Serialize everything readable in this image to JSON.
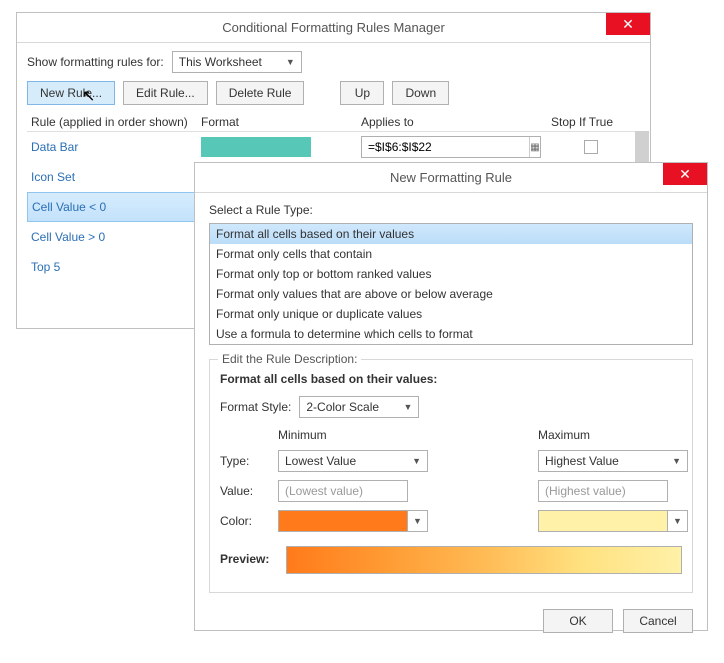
{
  "manager": {
    "title": "Conditional Formatting Rules Manager",
    "show_label": "Show formatting rules for:",
    "scope": "This Worksheet",
    "buttons": {
      "new": "New Rule...",
      "edit": "Edit Rule...",
      "delete": "Delete Rule",
      "up": "Up",
      "down": "Down"
    },
    "columns": {
      "rule": "Rule (applied in order shown)",
      "format": "Format",
      "applies": "Applies to",
      "stop": "Stop If True"
    },
    "rules": [
      {
        "name": "Data Bar",
        "applies": "=$I$6:$I$22"
      },
      {
        "name": "Icon Set"
      },
      {
        "name": "Cell Value < 0"
      },
      {
        "name": "Cell Value > 0"
      },
      {
        "name": "Top 5"
      }
    ]
  },
  "newRule": {
    "title": "New Formatting Rule",
    "select_label": "Select a Rule Type:",
    "types": [
      "Format all cells based on their values",
      "Format only cells that contain",
      "Format only top or bottom ranked values",
      "Format only values that are above or below average",
      "Format only unique or duplicate values",
      "Use a formula to determine which cells to format"
    ],
    "edit_legend": "Edit the Rule Description:",
    "heading": "Format all cells based on their values:",
    "format_style_label": "Format Style:",
    "format_style": "2-Color Scale",
    "min_label": "Minimum",
    "max_label": "Maximum",
    "type_label": "Type:",
    "value_label": "Value:",
    "color_label": "Color:",
    "min_type": "Lowest Value",
    "max_type": "Highest Value",
    "min_placeholder": "(Lowest value)",
    "max_placeholder": "(Highest value)",
    "min_color": "#ff7a1a",
    "max_color": "#fff1a8",
    "preview_label": "Preview:",
    "ok": "OK",
    "cancel": "Cancel"
  }
}
